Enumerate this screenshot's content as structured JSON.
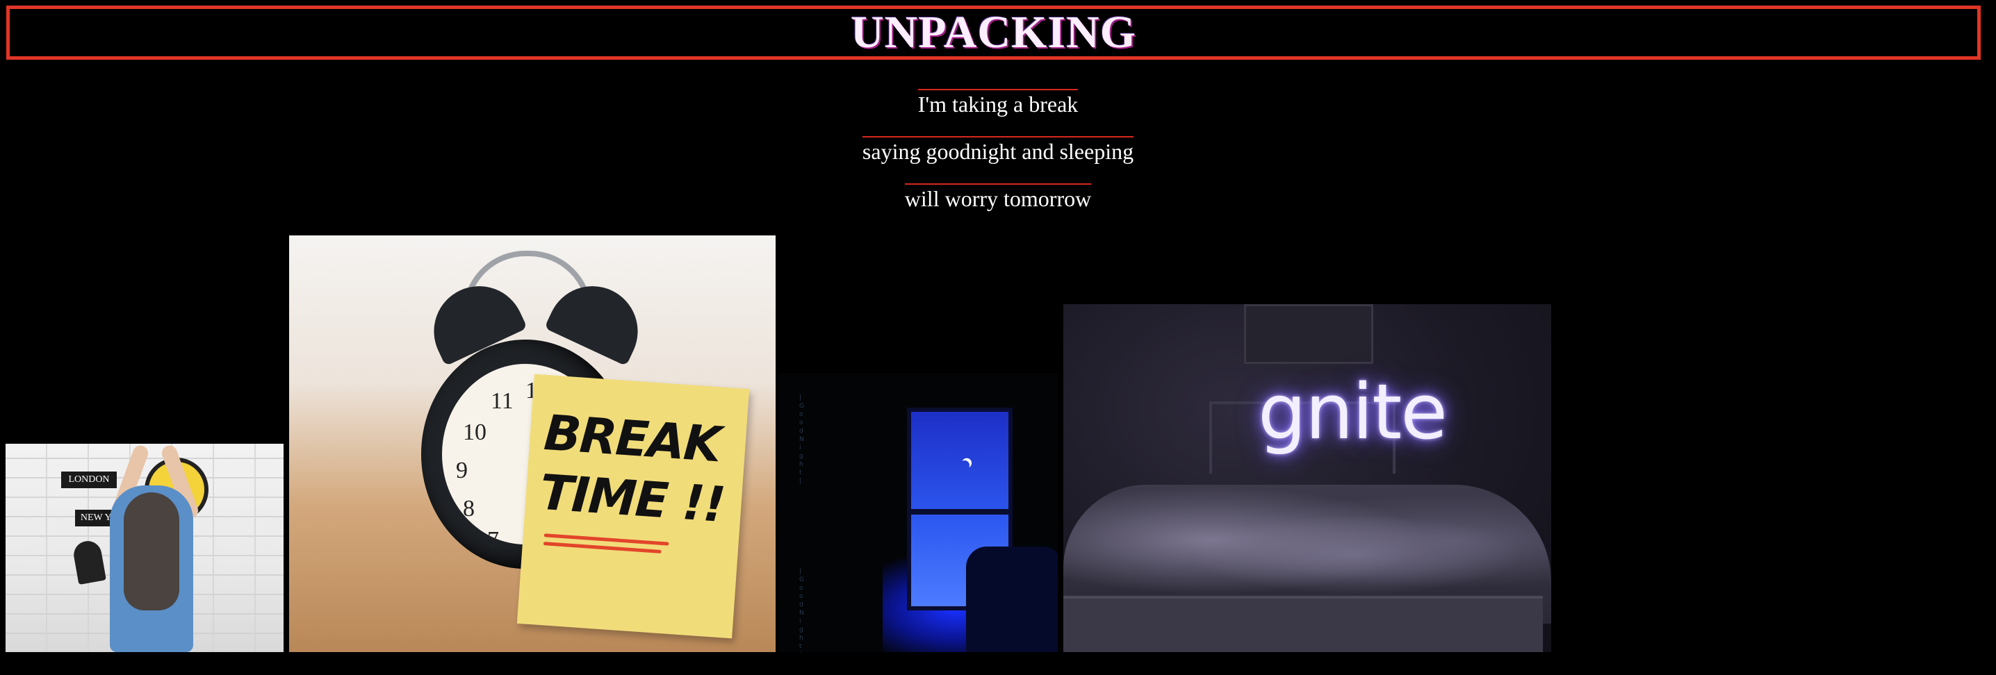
{
  "page": {
    "title": "UNPACKING",
    "lines": [
      "I'm taking a break",
      "saying goodnight and sleeping",
      "will worry tomorrow"
    ]
  },
  "photos": {
    "p1": {
      "signs": [
        "LONDON",
        "NEW YORK"
      ]
    },
    "p2": {
      "note_text_line1": "BREAK",
      "note_text_line2": "TIME !!",
      "clock_numbers": [
        "11",
        "10",
        "9",
        "8",
        "7",
        "1"
      ]
    },
    "p3": {
      "side_text_top": "| Good Night |",
      "side_text_bottom": "| Good Night |"
    },
    "p4": {
      "neon_text": "gnite"
    }
  },
  "colors": {
    "background": "#000000",
    "title_border": "#e03526",
    "line_rule": "#d6281c",
    "text": "#ffffff"
  }
}
